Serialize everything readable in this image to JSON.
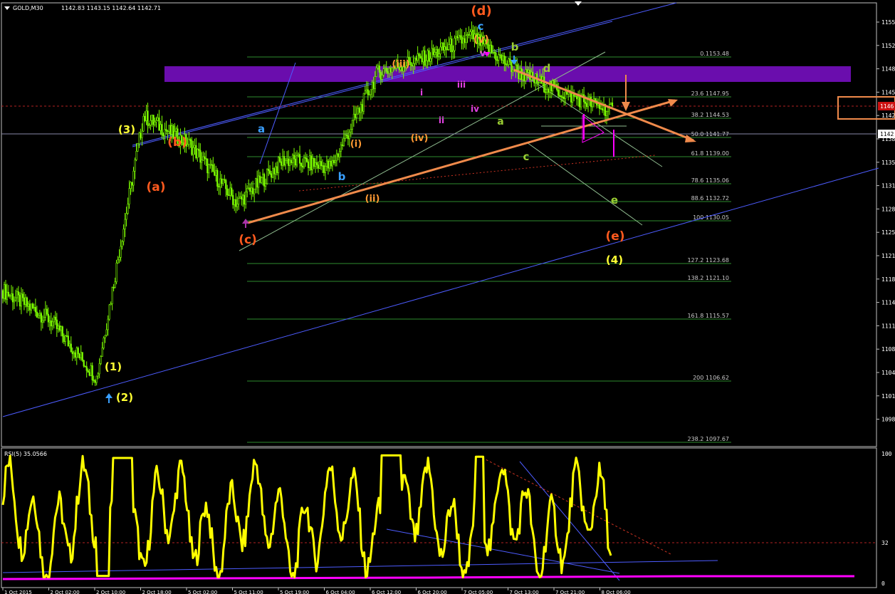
{
  "header": {
    "symbol_label": "GOLD,M30",
    "ohlc": "1142.83 1143.15 1142.64 1142.71",
    "current_price_tag": "1142.",
    "marked_price_tag": "1146."
  },
  "rsi_panel": {
    "label": "RSI(5) 35.0566",
    "axis_labels": [
      "100",
      "32",
      "0"
    ]
  },
  "price_axis_labels": [
    "1155",
    "1152",
    "1148",
    "1145",
    "1142",
    "1138",
    "1135",
    "1131",
    "1128",
    "1125",
    "1121",
    "1118",
    "1114",
    "1111",
    "1108",
    "1104",
    "1101",
    "1098"
  ],
  "time_axis_labels": [
    "1 Oct 2015",
    "2 Oct 02:00",
    "2 Oct 10:00",
    "2 Oct 18:00",
    "5 Oct 02:00",
    "5 Oct 11:00",
    "5 Oct 19:00",
    "6 Oct 04:00",
    "6 Oct 12:00",
    "6 Oct 20:00",
    "7 Oct 05:00",
    "7 Oct 13:00",
    "7 Oct 21:00",
    "8 Oct 06:00"
  ],
  "fib_levels": [
    {
      "label": "0.1153.48"
    },
    {
      "label": "23.6 1147.95"
    },
    {
      "label": "38.2 1144.53"
    },
    {
      "label": "50.0 1141.77"
    },
    {
      "label": "61.8 1139.00"
    },
    {
      "label": "78.6 1135.06"
    },
    {
      "label": "88.6 1132.72"
    },
    {
      "label": "100 1130.05"
    },
    {
      "label": "127.2 1123.68"
    },
    {
      "label": "138.2 1121.10"
    },
    {
      "label": "161.8 1115.57"
    },
    {
      "label": "200 1106.62"
    },
    {
      "label": "238.2 1097.67"
    }
  ],
  "wave_labels": [
    {
      "text": "(d)",
      "color": "#ff5a1e"
    },
    {
      "text": "c",
      "color": "#3aa0ff"
    },
    {
      "text": "(v)",
      "color": "#ff9933"
    },
    {
      "text": "v",
      "color": "#e040e0"
    },
    {
      "text": "b",
      "color": "#9acd32"
    },
    {
      "text": "d",
      "color": "#9acd32"
    },
    {
      "text": "(iii)",
      "color": "#ff9933"
    },
    {
      "text": "i",
      "color": "#e040e0"
    },
    {
      "text": "iii",
      "color": "#e040e0"
    },
    {
      "text": "ii",
      "color": "#e040e0"
    },
    {
      "text": "iv",
      "color": "#e040e0"
    },
    {
      "text": "a",
      "color": "#9acd32"
    },
    {
      "text": "(iv)",
      "color": "#ff9933"
    },
    {
      "text": "c",
      "color": "#9acd32"
    },
    {
      "text": "(3)",
      "color": "#ffff33"
    },
    {
      "text": "(b)",
      "color": "#ff5a1e"
    },
    {
      "text": "a",
      "color": "#3aa0ff"
    },
    {
      "text": "(i)",
      "color": "#ff9933"
    },
    {
      "text": "b",
      "color": "#3aa0ff"
    },
    {
      "text": "(ii)",
      "color": "#ff9933"
    },
    {
      "text": "(a)",
      "color": "#ff5a1e"
    },
    {
      "text": "(c)",
      "color": "#ff5a1e"
    },
    {
      "text": "e",
      "color": "#9acd32"
    },
    {
      "text": "(e)",
      "color": "#ff5a1e"
    },
    {
      "text": "(4)",
      "color": "#ffff33"
    },
    {
      "text": "(1)",
      "color": "#ffff33"
    },
    {
      "text": "(2)",
      "color": "#ffff33"
    }
  ],
  "colors": {
    "background": "#000000",
    "candle": "#7cfc00",
    "rsi_line": "#ffff00",
    "fib": "#2e8b2e",
    "channel": "#4d5cff",
    "trend_orange": "#f08a4b",
    "resistance_zone": "#6a0dad",
    "magenta": "#ff00ff"
  },
  "chart_data": {
    "type": "line",
    "x": [
      "1 Oct 2015",
      "2 Oct 02:00",
      "2 Oct 10:00",
      "2 Oct 18:00",
      "5 Oct 02:00",
      "5 Oct 11:00",
      "5 Oct 19:00",
      "6 Oct 04:00",
      "6 Oct 12:00",
      "6 Oct 20:00",
      "7 Oct 05:00",
      "7 Oct 13:00",
      "7 Oct 21:00",
      "8 Oct 06:00"
    ],
    "series": [
      {
        "values": [
          1118,
          1114,
          1106,
          1142,
          1138,
          1130,
          1136,
          1135,
          1148,
          1150,
          1153,
          1148,
          1145,
          1142.7
        ]
      }
    ],
    "ylim": [
      1097,
      1157
    ],
    "rsi": {
      "label": "RSI(5) 35.0566",
      "ylim": [
        0,
        100
      ],
      "levels": [
        32
      ]
    },
    "resistance_zone": [
      1149.5,
      1152.5
    ],
    "marked_level": 1146.6
  }
}
